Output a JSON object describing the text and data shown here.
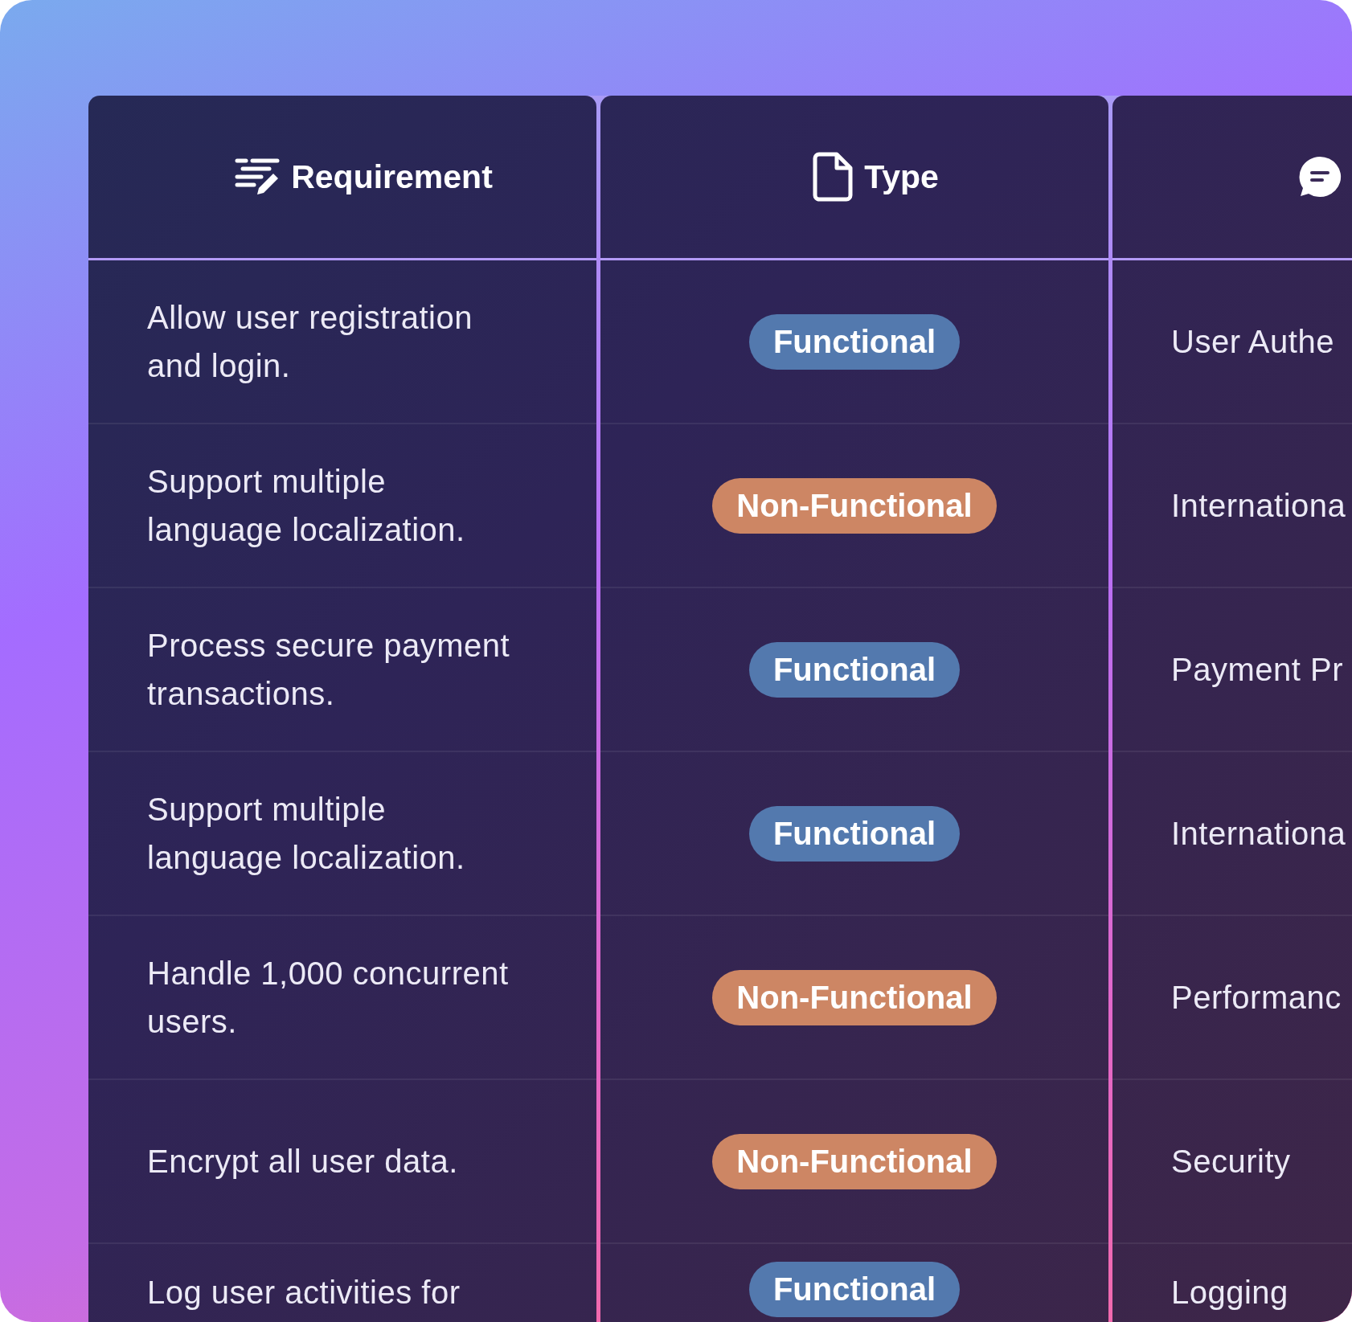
{
  "table": {
    "columns": [
      {
        "label": "Requirement",
        "kind": "requirement"
      },
      {
        "label": "Type",
        "kind": "type"
      },
      {
        "kind": "notes"
      }
    ],
    "rows": [
      {
        "requirement": "Allow user registration and login.",
        "type": {
          "label": "Functional",
          "kind": "functional"
        },
        "column_3": "User Authe"
      },
      {
        "requirement": "Support multiple language localization.",
        "type": {
          "label": "Non-Functional",
          "kind": "non-functional"
        },
        "column_3": "Internationa"
      },
      {
        "requirement": "Process secure payment transactions.",
        "type": {
          "label": "Functional",
          "kind": "functional"
        },
        "column_3": "Payment Pr"
      },
      {
        "requirement": "Support multiple language localization.",
        "type": {
          "label": "Functional",
          "kind": "functional"
        },
        "column_3": "Internationa"
      },
      {
        "requirement": "Handle 1,000 concurrent users.",
        "type": {
          "label": "Non-Functional",
          "kind": "non-functional"
        },
        "column_3": "Performanc"
      },
      {
        "requirement": "Encrypt all user data.",
        "type": {
          "label": "Non-Functional",
          "kind": "non-functional"
        },
        "column_3": "Security"
      },
      {
        "requirement": "Log user activities for",
        "type": {
          "label": "Functional",
          "kind": "functional"
        },
        "column_3": "Logging"
      }
    ]
  }
}
